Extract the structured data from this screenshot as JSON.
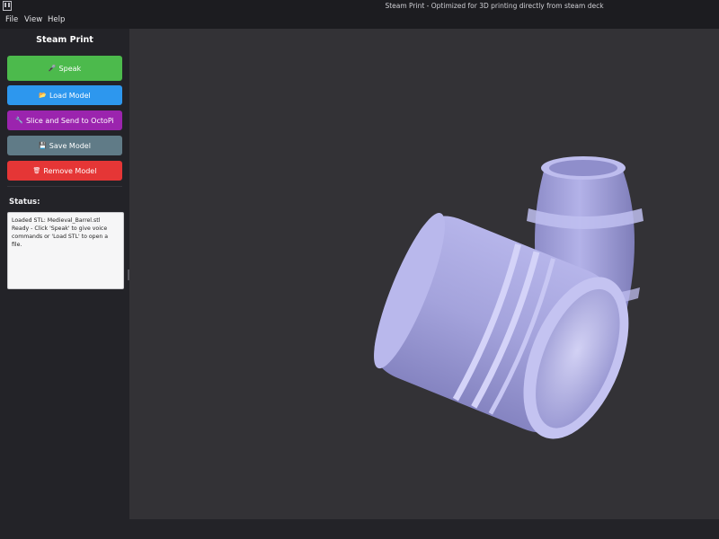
{
  "window": {
    "title": "Steam Print - Optimized for 3D printing directly from steam deck"
  },
  "menu": {
    "items": [
      "File",
      "View",
      "Help"
    ]
  },
  "sidebar": {
    "app_name": "Steam Print",
    "buttons": {
      "speak": {
        "label": "Speak",
        "icon": "microphone-icon",
        "color": "#4cba4c"
      },
      "load": {
        "label": "Load Model",
        "icon": "folder-icon",
        "color": "#2d97ee"
      },
      "slice": {
        "label": "Slice and Send to OctoPi",
        "icon": "wrench-icon",
        "color": "#9b24ae"
      },
      "save": {
        "label": "Save Model",
        "icon": "save-icon",
        "color": "#607b87"
      },
      "remove": {
        "label": "Remove Model",
        "icon": "trash-icon",
        "color": "#e53636"
      }
    },
    "status": {
      "heading": "Status:",
      "text": "Loaded STL: Medieval_Barrel.stl\nReady - Click 'Speak' to give voice commands or 'Load STL' to open a file."
    }
  },
  "viewport": {
    "background_color": "#333236",
    "model_color": "#a9a8e0"
  }
}
